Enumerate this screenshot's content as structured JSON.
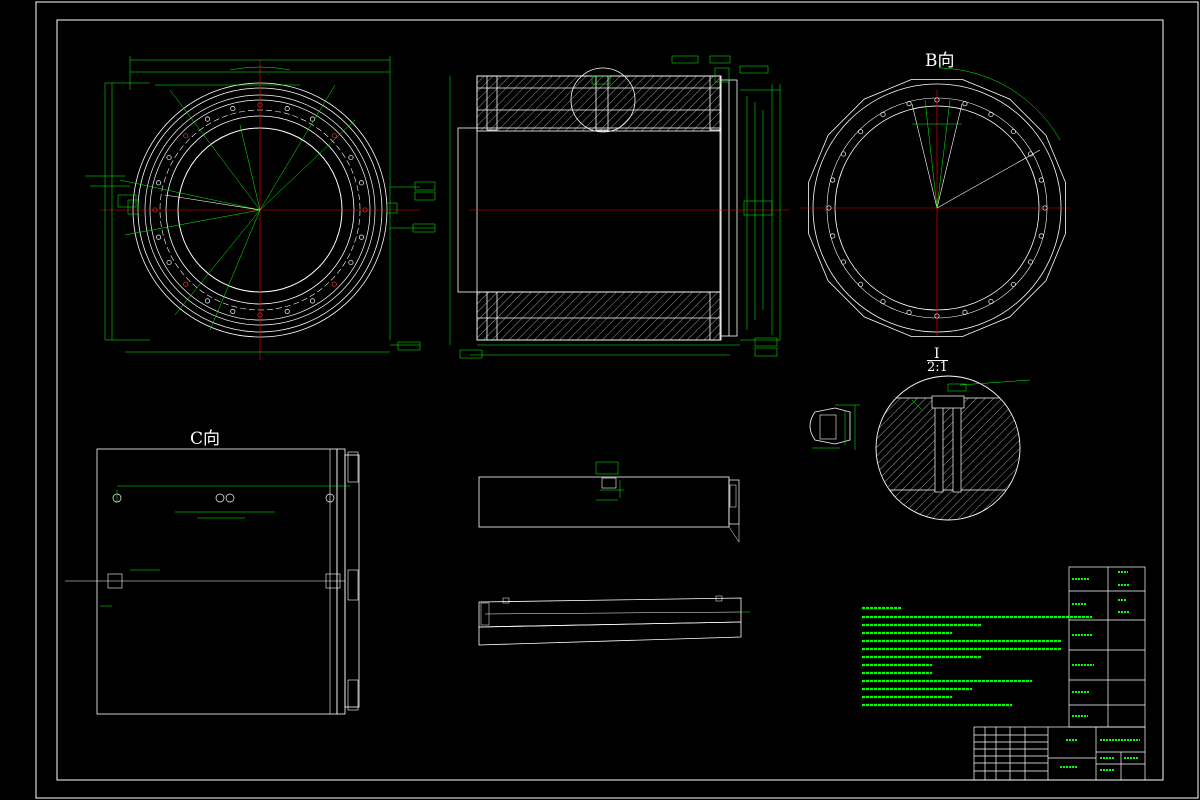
{
  "view_b_label": "B向",
  "view_c_label": "C向",
  "detail_label_roman": "I",
  "detail_label_scale": "2:1",
  "colors": {
    "geometry": "#ffffff",
    "dimension": "#00ff00",
    "centerline": "#ff0000",
    "holes": "#ff3030"
  },
  "views": [
    "front-circular-view",
    "section-view",
    "view-b",
    "view-c",
    "detail-I",
    "strip-views",
    "technical-notes",
    "title-block"
  ]
}
